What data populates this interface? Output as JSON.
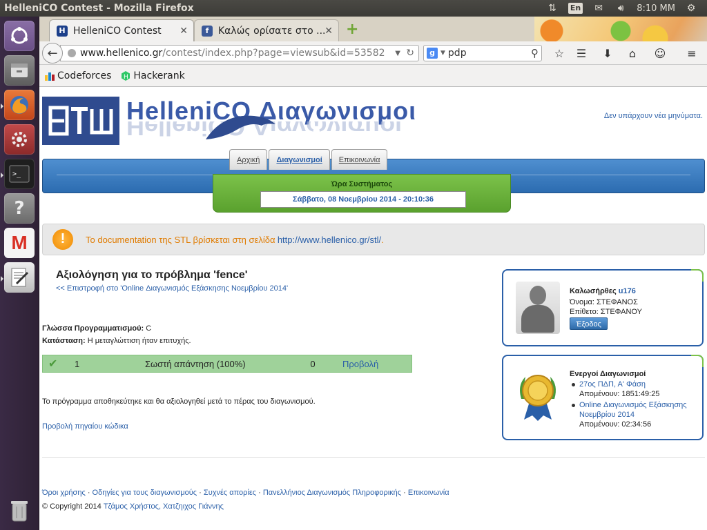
{
  "os_panel": {
    "window_title": "HelleniCO Contest - Mozilla Firefox",
    "lang": "En",
    "clock": "8:10 MM"
  },
  "browser": {
    "tabs": [
      {
        "label": "HelleniCO Contest",
        "active": true
      },
      {
        "label": "Καλώς ορίσατε στο ...",
        "active": false
      }
    ],
    "url_host": "www.hellenico.gr",
    "url_path": "/contest/index.php?page=viewsub&id=53582",
    "search_query": "pdp",
    "bookmarks": [
      "Codeforces",
      "Hackerank"
    ]
  },
  "site": {
    "logo_title": "HelleniCO Διαγωνισμοι",
    "messages": "Δεν υπάρχουν νέα μηνύματα.",
    "menu": [
      "Αρχική",
      "Διαγωνισμοί",
      "Επικοινωνία"
    ],
    "system_time_label": "Ώρα Συστήματος",
    "system_time": "Σάββατο, 08 Νοεμβρίου 2014 - 20:10:36",
    "notice_text": "Το documentation της STL βρίσκεται στη σελίδα",
    "notice_url": "http://www.hellenico.gr/stl/",
    "notice_tail": "."
  },
  "evaluation": {
    "title": "Αξιολόγηση για το πρόβλημα 'fence'",
    "back_link": "<< Επιστροφή στο 'Online Διαγωνισμός Εξάσκησης Νοεμβρίου 2014'",
    "lang_label": "Γλώσσα Προγραμματισμού:",
    "lang_value": "C",
    "status_label": "Κατάσταση:",
    "status_value": "Η μεταγλώττιση ήταν επιτυχής.",
    "result": {
      "number": "1",
      "status": "Σωστή απάντηση (100%)",
      "score": "0",
      "view": "Προβολή"
    },
    "note": "Το πρόγραμμα αποθηκεύτηκε και θα αξιολογηθεί μετά το πέρας του διαγωνισμού.",
    "source_link": "Προβολή πηγαίου κώδικα"
  },
  "user_panel": {
    "greeting": "Καλωσήρθες",
    "username": "u176",
    "first_name": "Όνομα: ΣΤΕΦΑΝΟΣ",
    "last_name": "Επίθετο: ΣΤΕΦΑΝΟΥ",
    "logout": "Έξοδος"
  },
  "active_contests": {
    "title": "Ενεργοί Διαγωνισμοί",
    "items": [
      {
        "name": "27ος ΠΔΠ, Α' Φάση",
        "remaining": "Απομένουν: 1851:49:25"
      },
      {
        "name": "Online Διαγωνισμός Εξάσκησης Νοεμβρίου 2014",
        "remaining": "Απομένουν: 02:34:56"
      }
    ]
  },
  "footer": {
    "links": [
      "Όροι χρήσης",
      "Οδηγίες για τους διαγωνισμούς",
      "Συχνές απορίες",
      "Πανελλήνιος Διαγωνισμός Πληροφορικής",
      "Επικοινωνία"
    ],
    "copyright_prefix": "© Copyright 2014",
    "authors": "Τζάμος Χρήστος, Χατζηιχος Γιάννης"
  }
}
